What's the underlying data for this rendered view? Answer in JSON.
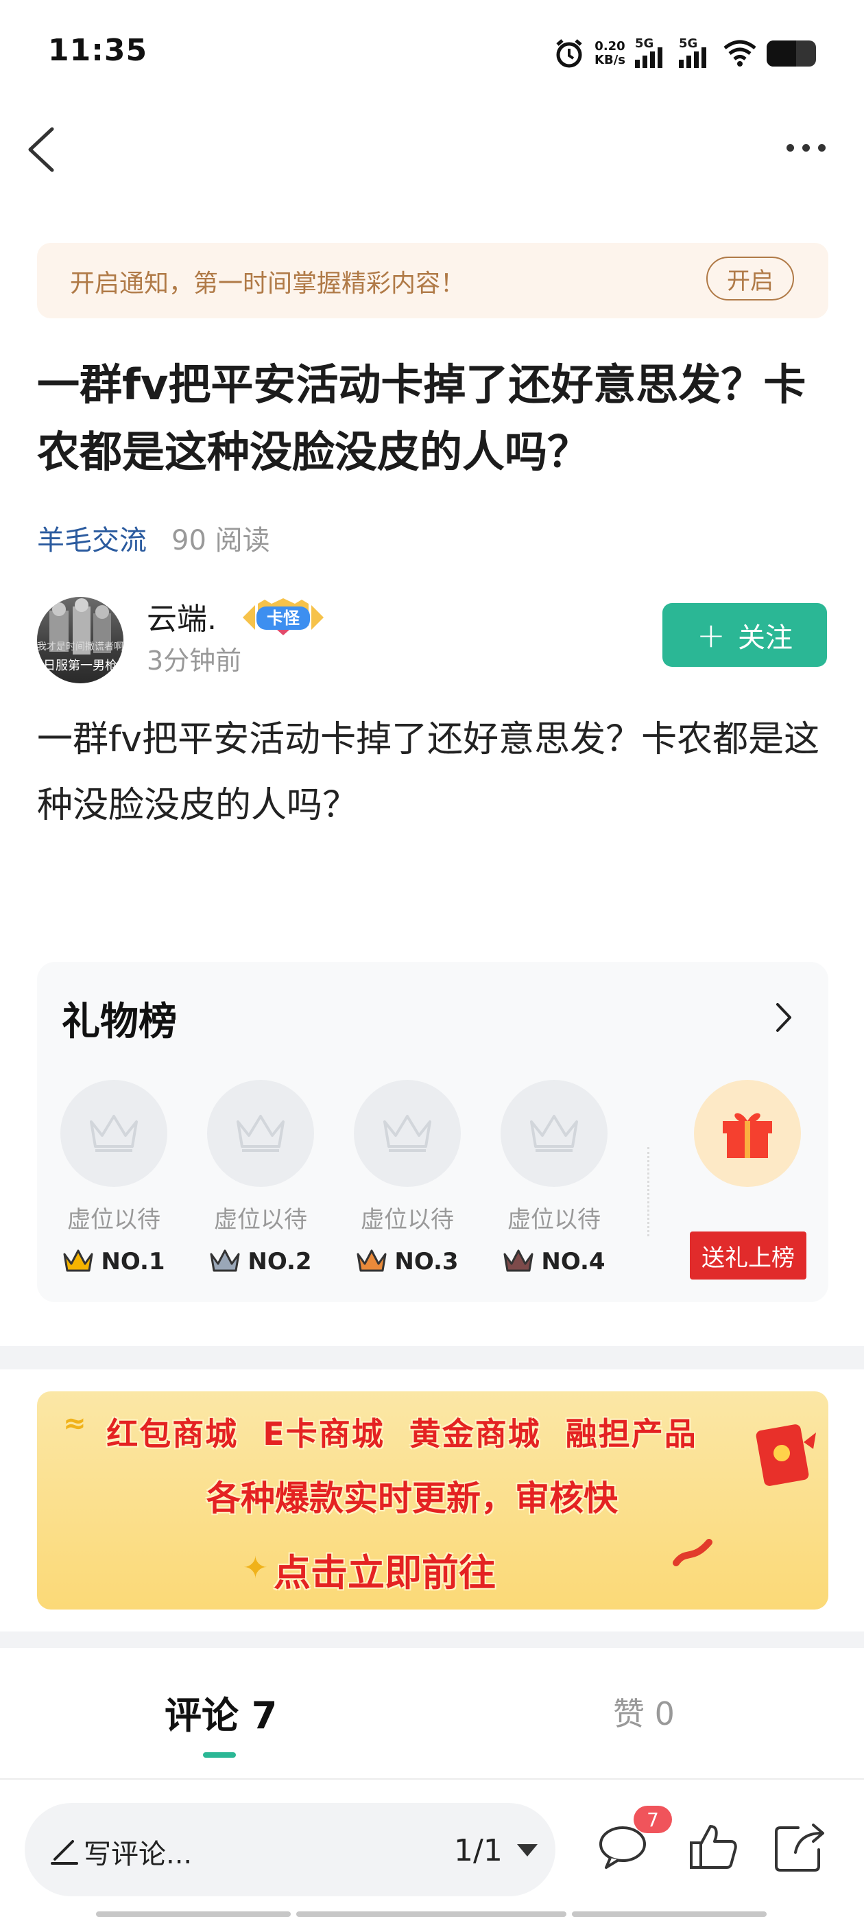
{
  "status_bar": {
    "time": "11:35",
    "net_speed_value": "0.20",
    "net_speed_unit": "KB/s",
    "signal1_label": "5G",
    "signal2_label": "5G",
    "icons": [
      "alarm-icon",
      "signal-icon",
      "wifi-icon",
      "battery-icon"
    ]
  },
  "nav": {
    "back_icon": "chevron-left-icon",
    "more_icon": "more-dots-icon"
  },
  "notification": {
    "text": "开启通知，第一时间掌握精彩内容！",
    "button_label": "开启"
  },
  "post": {
    "title": "一群fv把平安活动卡掉了还好意思发？卡农都是这种没脸没皮的人吗？",
    "category": "羊毛交流",
    "reads": "90 阅读",
    "body": "一群fv把平安活动卡掉了还好意思发？卡农都是这种没脸没皮的人吗？"
  },
  "author": {
    "name": "云端.",
    "badge_label": "卡怪",
    "time": "3分钟前",
    "avatar_caption": "日服第一男枪",
    "avatar_caption_top": "我才是时间撒谎者啊",
    "follow_label": "关注"
  },
  "gift_board": {
    "title": "礼物榜",
    "slots": [
      {
        "label": "虚位以待",
        "rank": "NO.1",
        "color": "#f5b400"
      },
      {
        "label": "虚位以待",
        "rank": "NO.2",
        "color": "#9aa7b8"
      },
      {
        "label": "虚位以待",
        "rank": "NO.3",
        "color": "#e98a3a"
      },
      {
        "label": "虚位以待",
        "rank": "NO.4",
        "color": "#7d4a4a"
      }
    ],
    "send_label": "送礼上榜"
  },
  "promo": {
    "items": [
      "红包商城",
      "E卡商城",
      "黄金商城",
      "融担产品"
    ],
    "line2": "各种爆款实时更新，审核快",
    "line3": "点击立即前往"
  },
  "tabs": {
    "comments": "评论 7",
    "likes": "赞 0"
  },
  "bottom_bar": {
    "placeholder": "写评论...",
    "page": "1/1",
    "comment_count": "7",
    "accent": "#2bb795"
  }
}
